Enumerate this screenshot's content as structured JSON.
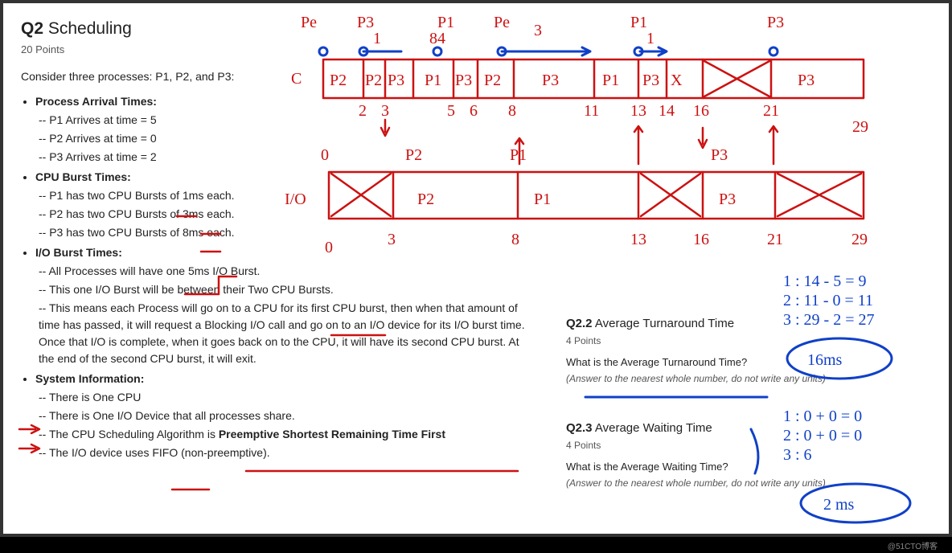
{
  "question": {
    "number": "Q2",
    "title": "Scheduling",
    "points": "20 Points",
    "intro": "Consider three processes: P1, P2, and P3:"
  },
  "arrival": {
    "header": "Process Arrival Times:",
    "p1": "-- P1 Arrives at time = 5",
    "p2": "-- P2 Arrives at time = 0",
    "p3": "-- P3 Arrives at time = 2"
  },
  "cpu": {
    "header": "CPU Burst Times:",
    "p1": "-- P1 has two CPU Bursts of 1ms each.",
    "p2": "-- P2 has two CPU Bursts of 3ms each.",
    "p3": "-- P3 has two CPU Bursts of 8ms each."
  },
  "io": {
    "header": "I/O Burst Times:",
    "l1": "-- All Processes will have one 5ms I/O Burst.",
    "l2": "-- This one I/O Burst will be between their Two CPU Bursts.",
    "l3": "-- This means each Process will go on to a CPU for its first CPU burst, then when that amount of time has passed, it will request a Blocking I/O call and go on to an I/O device for its I/O burst time.  Once that I/O is complete, when it goes back on to the CPU, it will have its second CPU burst.  At the end of the second CPU burst, it will exit."
  },
  "sys": {
    "header": "System Information:",
    "l1": "-- There is One CPU",
    "l2": "-- There is One I/O Device that all processes share.",
    "l3a": "-- The CPU Scheduling Algorithm is ",
    "l3b": "Preemptive Shortest Remaining Time First",
    "l4": "-- The I/O device uses FIFO (non-preemptive)."
  },
  "q22": {
    "hdr_num": "Q2.2",
    "hdr_txt": " Average Turnaround Time",
    "pts": "4 Points",
    "ask": "What is the Average Turnaround Time?",
    "note": "(Answer to the nearest whole number, do not write any units)"
  },
  "q23": {
    "hdr_num": "Q2.3",
    "hdr_txt": " Average Waiting Time",
    "pts": "4 Points",
    "ask": "What is the Average Waiting Time?",
    "note": "(Answer to the nearest whole number, do not write any units)"
  },
  "hand": {
    "gantt_cpu": {
      "label": "C",
      "ticks": [
        "0",
        "2",
        "3",
        "5",
        "6",
        "8",
        "11",
        "13",
        "14",
        "16",
        "21",
        "29"
      ],
      "slots": [
        "P2",
        "P2",
        "P3",
        "P1",
        "P3",
        "P2",
        "P3",
        "P1",
        "P3",
        "X",
        "P3"
      ],
      "arrivals": [
        "Pe",
        "P3",
        "P1",
        "Pe",
        "P1"
      ]
    },
    "gantt_io": {
      "label": "I/O",
      "ticks": [
        "0",
        "3",
        "8",
        "13",
        "16",
        "21",
        "29"
      ],
      "slots": [
        "X",
        "P2",
        "P1",
        "X",
        "P3",
        "X"
      ]
    },
    "turnaround_calc": {
      "l1": "1 : 14 - 5 = 9",
      "l2": "2 : 11 - 0 = 11",
      "l3": "3 : 29 - 2 = 27",
      "ans": "16ms"
    },
    "waiting_calc": {
      "l1": "1 : 0 + 0 = 0",
      "l2": "2 : 0 + 0 = 0",
      "l3": "3 :  6",
      "ans": "2 ms"
    },
    "misc_nums": [
      "84",
      "3",
      "1"
    ]
  },
  "footer": "@51CTO博客"
}
